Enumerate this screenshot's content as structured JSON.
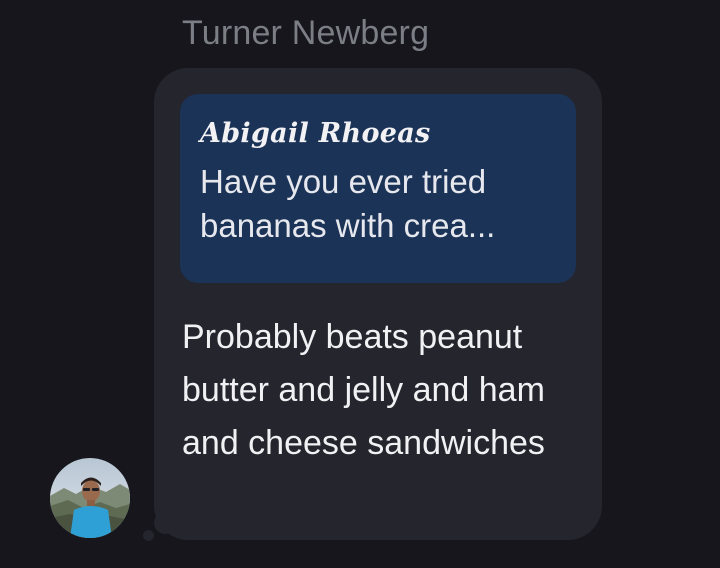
{
  "message": {
    "sender_name": "Turner Newberg",
    "reply": {
      "author": "Abigail Rhoeas",
      "snippet": "Have you ever tried bananas with crea..."
    },
    "body": "Probably beats peanut butter and jelly and ham and cheese sandwiches"
  },
  "avatar": {
    "icon": "profile-photo",
    "shirt_color": "#2fa0d6"
  },
  "colors": {
    "background": "#16161c",
    "bubble": "#24252d",
    "reply_quote": "#1c3358",
    "sender_name": "#7c7e86",
    "text": "#f1f1f4"
  }
}
